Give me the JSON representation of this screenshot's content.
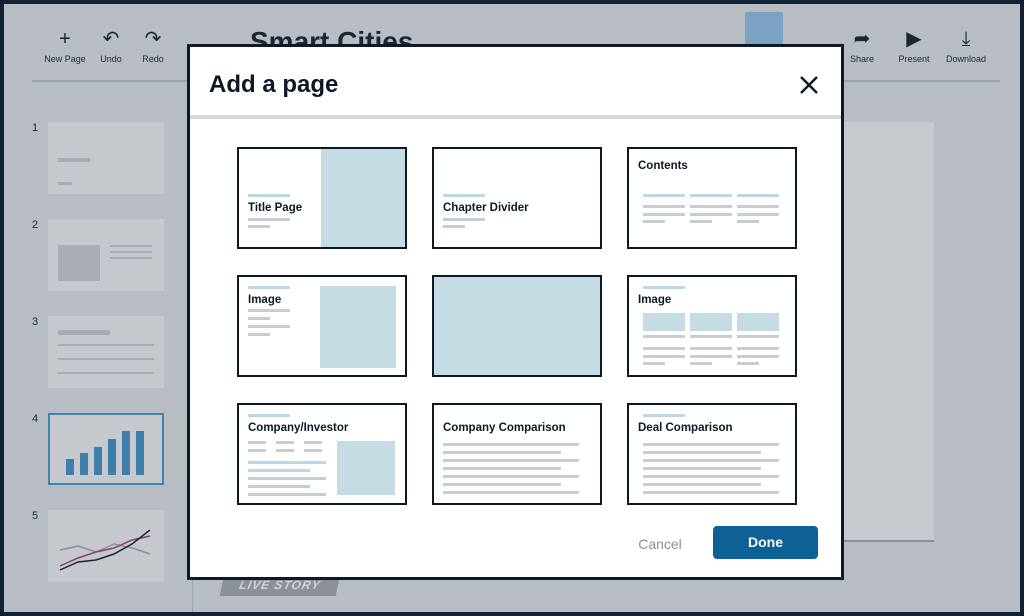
{
  "app": {
    "document_title": "Smart Cities",
    "toolbar": [
      {
        "id": "new-page",
        "label": "New Page",
        "icon": "plus-icon"
      },
      {
        "id": "undo",
        "label": "Undo",
        "icon": "undo-icon"
      },
      {
        "id": "redo",
        "label": "Redo",
        "icon": "redo-icon"
      },
      {
        "id": "share",
        "label": "Share",
        "icon": "share-icon"
      },
      {
        "id": "present",
        "label": "Present",
        "icon": "play-icon"
      },
      {
        "id": "download",
        "label": "Download",
        "icon": "download-icon"
      }
    ],
    "page_thumbnails": [
      "1",
      "2",
      "3",
      "4",
      "5"
    ],
    "selected_page": "4",
    "live_story_label": "LIVE STORY"
  },
  "modal": {
    "title": "Add a page",
    "close_icon": "close-icon",
    "templates": [
      {
        "id": "title-page",
        "label": "Title Page"
      },
      {
        "id": "chapter-divider",
        "label": "Chapter Divider"
      },
      {
        "id": "contents",
        "label": "Contents"
      },
      {
        "id": "image-left-text",
        "label": "Image"
      },
      {
        "id": "full-image",
        "label": ""
      },
      {
        "id": "image-three-columns",
        "label": "Image"
      },
      {
        "id": "company-investor",
        "label": "Company/Investor"
      },
      {
        "id": "company-comparison",
        "label": "Company Comparison"
      },
      {
        "id": "deal-comparison",
        "label": "Deal Comparison"
      }
    ],
    "cancel_label": "Cancel",
    "done_label": "Done"
  },
  "colors": {
    "primary": "#0d6196",
    "accent_light": "#c5dce5",
    "overlay": "#b8bcc3",
    "selected_thumbnail_border": "#3d84b6"
  }
}
